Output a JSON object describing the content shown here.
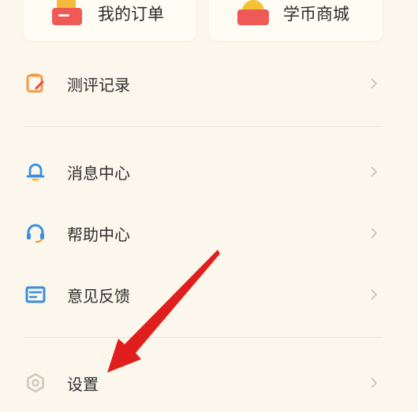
{
  "top_cards": [
    {
      "label": "我的订单",
      "icon": "order-folder-icon"
    },
    {
      "label": "学币商城",
      "icon": "coin-shop-icon"
    }
  ],
  "menu": {
    "evaluation_records": {
      "label": "测评记录",
      "icon": "clipboard-icon"
    },
    "messages": {
      "label": "消息中心",
      "icon": "bell-icon"
    },
    "help": {
      "label": "帮助中心",
      "icon": "headset-icon"
    },
    "feedback": {
      "label": "意见反馈",
      "icon": "mail-icon"
    },
    "settings": {
      "label": "设置",
      "icon": "gear-icon"
    }
  },
  "annotation": {
    "icon": "red-arrow-icon",
    "color": "#e01e1e"
  },
  "colors": {
    "background": "#fbf7ec",
    "accent_orange": "#f39a45",
    "accent_red": "#e84a47",
    "accent_blue": "#3a8ee0",
    "chevron": "#c8c2b6"
  }
}
